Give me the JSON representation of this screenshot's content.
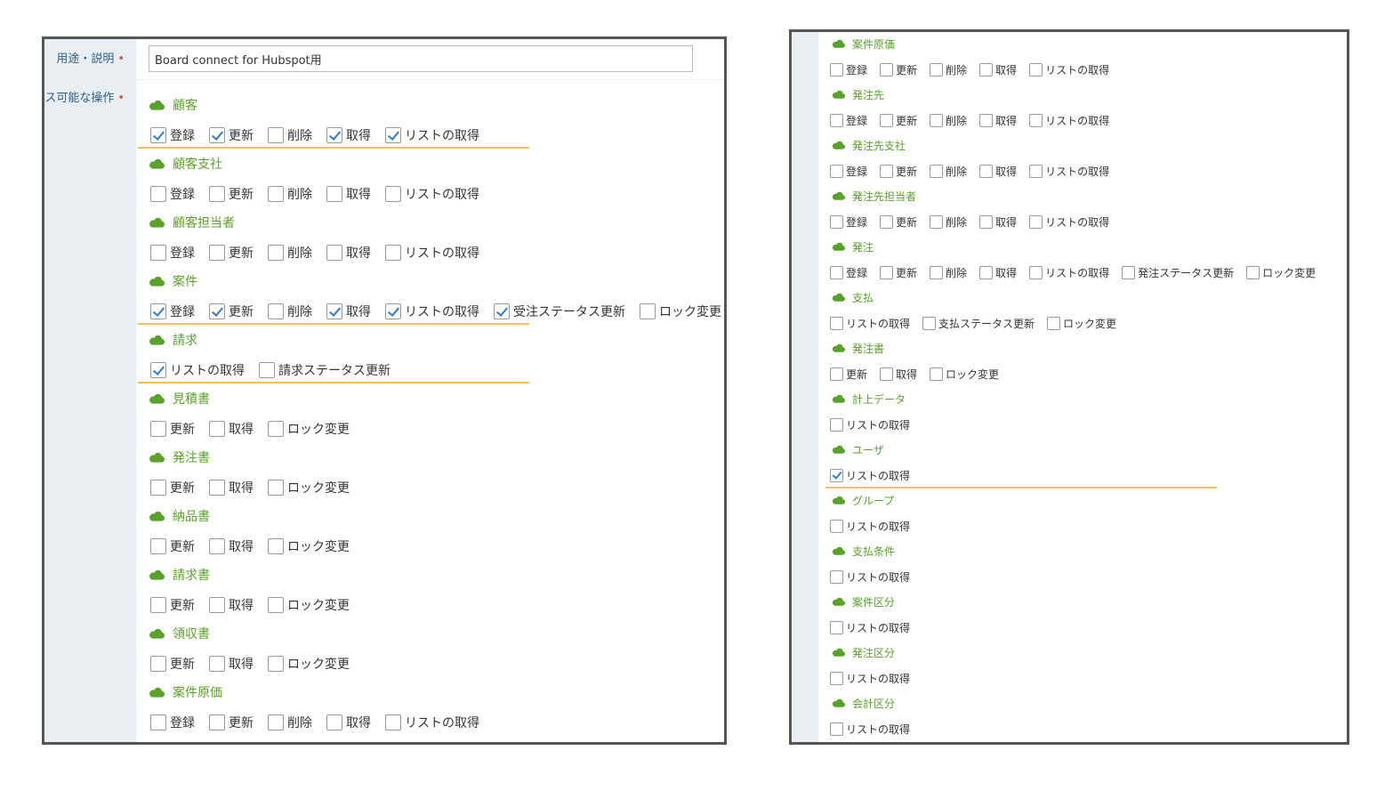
{
  "left": {
    "purpose_label": "用途・説明",
    "ops_label": "ス可能な操作",
    "required_mark": "•",
    "purpose_value": "Board connect for Hubspot用",
    "sections": [
      {
        "title": "顧客",
        "highlight": true,
        "options": [
          {
            "label": "登録",
            "checked": true
          },
          {
            "label": "更新",
            "checked": true
          },
          {
            "label": "削除",
            "checked": false
          },
          {
            "label": "取得",
            "checked": true
          },
          {
            "label": "リストの取得",
            "checked": true
          }
        ]
      },
      {
        "title": "顧客支社",
        "highlight": false,
        "options": [
          {
            "label": "登録",
            "checked": false
          },
          {
            "label": "更新",
            "checked": false
          },
          {
            "label": "削除",
            "checked": false
          },
          {
            "label": "取得",
            "checked": false
          },
          {
            "label": "リストの取得",
            "checked": false
          }
        ]
      },
      {
        "title": "顧客担当者",
        "highlight": false,
        "options": [
          {
            "label": "登録",
            "checked": false
          },
          {
            "label": "更新",
            "checked": false
          },
          {
            "label": "削除",
            "checked": false
          },
          {
            "label": "取得",
            "checked": false
          },
          {
            "label": "リストの取得",
            "checked": false
          }
        ]
      },
      {
        "title": "案件",
        "highlight": true,
        "options": [
          {
            "label": "登録",
            "checked": true
          },
          {
            "label": "更新",
            "checked": true
          },
          {
            "label": "削除",
            "checked": false
          },
          {
            "label": "取得",
            "checked": true
          },
          {
            "label": "リストの取得",
            "checked": true
          },
          {
            "label": "受注ステータス更新",
            "checked": true
          },
          {
            "label": "ロック変更",
            "checked": false
          }
        ]
      },
      {
        "title": "請求",
        "highlight": true,
        "options": [
          {
            "label": "リストの取得",
            "checked": true
          },
          {
            "label": "請求ステータス更新",
            "checked": false
          }
        ]
      },
      {
        "title": "見積書",
        "highlight": false,
        "options": [
          {
            "label": "更新",
            "checked": false
          },
          {
            "label": "取得",
            "checked": false
          },
          {
            "label": "ロック変更",
            "checked": false
          }
        ]
      },
      {
        "title": "発注書",
        "highlight": false,
        "options": [
          {
            "label": "更新",
            "checked": false
          },
          {
            "label": "取得",
            "checked": false
          },
          {
            "label": "ロック変更",
            "checked": false
          }
        ]
      },
      {
        "title": "納品書",
        "highlight": false,
        "options": [
          {
            "label": "更新",
            "checked": false
          },
          {
            "label": "取得",
            "checked": false
          },
          {
            "label": "ロック変更",
            "checked": false
          }
        ]
      },
      {
        "title": "請求書",
        "highlight": false,
        "options": [
          {
            "label": "更新",
            "checked": false
          },
          {
            "label": "取得",
            "checked": false
          },
          {
            "label": "ロック変更",
            "checked": false
          }
        ]
      },
      {
        "title": "領収書",
        "highlight": false,
        "options": [
          {
            "label": "更新",
            "checked": false
          },
          {
            "label": "取得",
            "checked": false
          },
          {
            "label": "ロック変更",
            "checked": false
          }
        ]
      },
      {
        "title": "案件原価",
        "highlight": false,
        "options": [
          {
            "label": "登録",
            "checked": false
          },
          {
            "label": "更新",
            "checked": false
          },
          {
            "label": "削除",
            "checked": false
          },
          {
            "label": "取得",
            "checked": false
          },
          {
            "label": "リストの取得",
            "checked": false
          }
        ]
      }
    ]
  },
  "right": {
    "sections": [
      {
        "title": "案件原価",
        "highlight": false,
        "options": [
          {
            "label": "登録",
            "checked": false
          },
          {
            "label": "更新",
            "checked": false
          },
          {
            "label": "削除",
            "checked": false
          },
          {
            "label": "取得",
            "checked": false
          },
          {
            "label": "リストの取得",
            "checked": false
          }
        ]
      },
      {
        "title": "発注先",
        "highlight": false,
        "options": [
          {
            "label": "登録",
            "checked": false
          },
          {
            "label": "更新",
            "checked": false
          },
          {
            "label": "削除",
            "checked": false
          },
          {
            "label": "取得",
            "checked": false
          },
          {
            "label": "リストの取得",
            "checked": false
          }
        ]
      },
      {
        "title": "発注先支社",
        "highlight": false,
        "options": [
          {
            "label": "登録",
            "checked": false
          },
          {
            "label": "更新",
            "checked": false
          },
          {
            "label": "削除",
            "checked": false
          },
          {
            "label": "取得",
            "checked": false
          },
          {
            "label": "リストの取得",
            "checked": false
          }
        ]
      },
      {
        "title": "発注先担当者",
        "highlight": false,
        "options": [
          {
            "label": "登録",
            "checked": false
          },
          {
            "label": "更新",
            "checked": false
          },
          {
            "label": "削除",
            "checked": false
          },
          {
            "label": "取得",
            "checked": false
          },
          {
            "label": "リストの取得",
            "checked": false
          }
        ]
      },
      {
        "title": "発注",
        "highlight": false,
        "options": [
          {
            "label": "登録",
            "checked": false
          },
          {
            "label": "更新",
            "checked": false
          },
          {
            "label": "削除",
            "checked": false
          },
          {
            "label": "取得",
            "checked": false
          },
          {
            "label": "リストの取得",
            "checked": false
          },
          {
            "label": "発注ステータス更新",
            "checked": false
          },
          {
            "label": "ロック変更",
            "checked": false
          }
        ]
      },
      {
        "title": "支払",
        "highlight": false,
        "options": [
          {
            "label": "リストの取得",
            "checked": false
          },
          {
            "label": "支払ステータス更新",
            "checked": false
          },
          {
            "label": "ロック変更",
            "checked": false
          }
        ]
      },
      {
        "title": "発注書",
        "highlight": false,
        "options": [
          {
            "label": "更新",
            "checked": false
          },
          {
            "label": "取得",
            "checked": false
          },
          {
            "label": "ロック変更",
            "checked": false
          }
        ]
      },
      {
        "title": "計上データ",
        "highlight": false,
        "options": [
          {
            "label": "リストの取得",
            "checked": false
          }
        ]
      },
      {
        "title": "ユーザ",
        "highlight": true,
        "options": [
          {
            "label": "リストの取得",
            "checked": true
          }
        ]
      },
      {
        "title": "グループ",
        "highlight": false,
        "options": [
          {
            "label": "リストの取得",
            "checked": false
          }
        ]
      },
      {
        "title": "支払条件",
        "highlight": false,
        "options": [
          {
            "label": "リストの取得",
            "checked": false
          }
        ]
      },
      {
        "title": "案件区分",
        "highlight": false,
        "options": [
          {
            "label": "リストの取得",
            "checked": false
          }
        ]
      },
      {
        "title": "発注区分",
        "highlight": false,
        "options": [
          {
            "label": "リストの取得",
            "checked": false
          }
        ]
      },
      {
        "title": "会計区分",
        "highlight": false,
        "options": [
          {
            "label": "リストの取得",
            "checked": false
          }
        ]
      }
    ]
  },
  "colors": {
    "accent_green": "#5aa02c",
    "check_blue": "#2b7bd1",
    "highlight_line": "#f5c04d",
    "label_blue": "#2e5f8a",
    "required_red": "#d9534f"
  },
  "icons": {
    "section": "cloud-icon"
  }
}
